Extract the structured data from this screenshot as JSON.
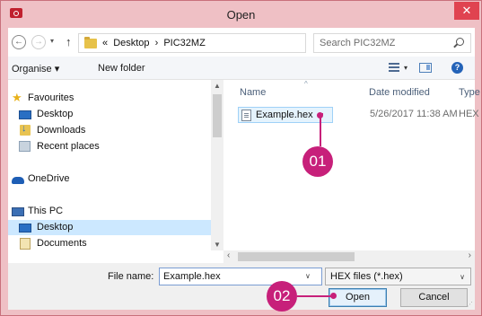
{
  "window": {
    "title": "Open",
    "close_glyph": "✕",
    "accent": "#e04350",
    "frame_color": "#efc0c5"
  },
  "address": {
    "back_glyph": "←",
    "forward_glyph": "→",
    "drop_glyph": "▾",
    "up_glyph": "↑",
    "crumbs": [
      "«",
      "Desktop",
      "›",
      "PIC32MZ"
    ],
    "path_drop_glyph": "∨",
    "refresh_glyph": "↻",
    "search_placeholder": "Search PIC32MZ"
  },
  "toolbar": {
    "organise": "Organise ▾",
    "new_folder": "New folder",
    "view_dd": "▾",
    "help": "?"
  },
  "nav": {
    "items": [
      {
        "label": "Favourites",
        "icon": "star-icon"
      },
      {
        "label": "Desktop",
        "icon": "desktop-icon"
      },
      {
        "label": "Downloads",
        "icon": "downloads-icon"
      },
      {
        "label": "Recent places",
        "icon": "recent-places-icon"
      },
      {
        "label": "OneDrive",
        "icon": "onedrive-icon"
      },
      {
        "label": "This PC",
        "icon": "pc-icon"
      },
      {
        "label": "Desktop",
        "icon": "desktop-icon"
      },
      {
        "label": "Documents",
        "icon": "documents-icon"
      }
    ],
    "scroll_up": "▲",
    "scroll_down": "▼"
  },
  "files": {
    "columns": [
      "Name",
      "Date modified",
      "Type"
    ],
    "sort_glyph": "^",
    "rows": [
      {
        "name": "Example.hex",
        "date": "5/26/2017 11:38 AM",
        "type": "HEX"
      }
    ],
    "scroll_left": "‹",
    "scroll_right": "›"
  },
  "bottom": {
    "file_name_label": "File name:",
    "file_name_value": "Example.hex",
    "file_name_drop": "∨",
    "file_type": "HEX files (*.hex)",
    "file_type_drop": "∨",
    "open_label": "Open",
    "cancel_label": "Cancel",
    "grip": "⋰"
  },
  "callouts": [
    {
      "label": "01",
      "color": "#c7207a"
    },
    {
      "label": "02",
      "color": "#c7207a"
    }
  ]
}
